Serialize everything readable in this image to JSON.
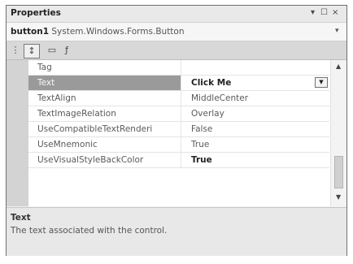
{
  "window": {
    "title": "Properties",
    "controls": {
      "pin": "▾",
      "autohide": "☐",
      "close": "×"
    }
  },
  "object_selector": {
    "name": "button1",
    "type": "System.Windows.Forms.Button",
    "arrow": "▾"
  },
  "toolbar": {
    "categorized": "⋮",
    "alphabetical": "↕",
    "properties": "▭",
    "events": "ƒ"
  },
  "grid": {
    "rows": [
      {
        "name": "Tag",
        "value": ""
      },
      {
        "name": "Text",
        "value": "Click Me",
        "selected": true,
        "bold": true,
        "dropdown": "▼"
      },
      {
        "name": "TextAlign",
        "value": "MiddleCenter"
      },
      {
        "name": "TextImageRelation",
        "value": "Overlay"
      },
      {
        "name": "UseCompatibleTextRenderi",
        "value": "False"
      },
      {
        "name": "UseMnemonic",
        "value": "True"
      },
      {
        "name": "UseVisualStyleBackColor",
        "value": "True",
        "bold": true
      }
    ],
    "scroll": {
      "up": "▲",
      "down": "▼"
    }
  },
  "description": {
    "title": "Text",
    "text": "The text associated with the control."
  }
}
